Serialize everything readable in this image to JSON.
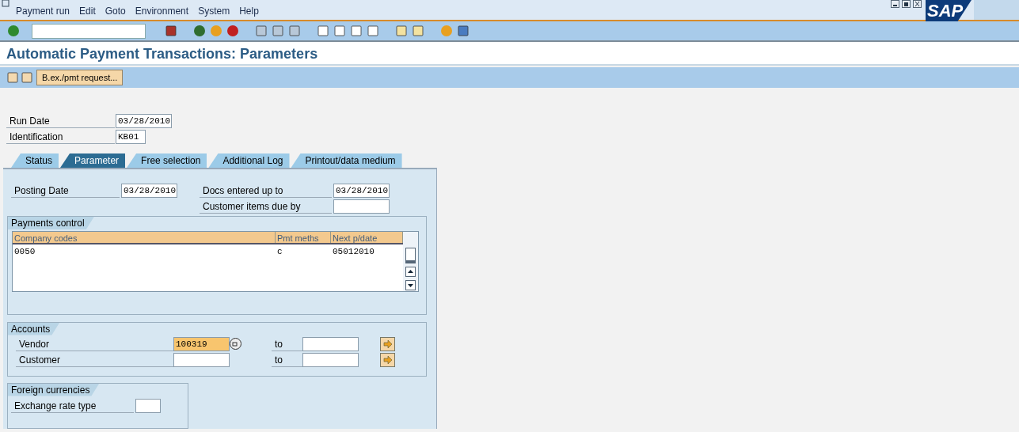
{
  "menu": [
    "Payment run",
    "Edit",
    "Goto",
    "Environment",
    "System",
    "Help"
  ],
  "logo": "SAP",
  "title": "Automatic Payment Transactions: Parameters",
  "app_toolbar": {
    "button": "B.ex./pmt request..."
  },
  "header_fields": [
    {
      "label": "Run Date",
      "value": "03/28/2010"
    },
    {
      "label": "Identification",
      "value": "KB01"
    }
  ],
  "tabs": [
    {
      "label": "Status",
      "selected": false
    },
    {
      "label": "Parameter",
      "selected": true
    },
    {
      "label": "Free selection",
      "selected": false
    },
    {
      "label": "Additional Log",
      "selected": false
    },
    {
      "label": "Printout/data medium",
      "selected": false
    }
  ],
  "posting_date": {
    "label": "Posting Date",
    "value": "03/28/2010"
  },
  "docs_entered": {
    "label": "Docs entered up to",
    "value": "03/28/2010"
  },
  "customer_items": {
    "label": "Customer items due by"
  },
  "payments_control": {
    "title": "Payments control",
    "columns": [
      "Company codes",
      "Pmt meths",
      "Next p/date"
    ],
    "rows": [
      [
        "0050",
        "c",
        "05012010"
      ]
    ]
  },
  "accounts": {
    "title": "Accounts",
    "rows": [
      {
        "label": "Vendor",
        "from": "100319",
        "focused": true,
        "to_label": "to"
      },
      {
        "label": "Customer",
        "focused": false,
        "to_label": "to"
      }
    ]
  },
  "foreign_currencies": {
    "title": "Foreign currencies",
    "fields": [
      {
        "label": "Exchange rate type"
      }
    ]
  }
}
